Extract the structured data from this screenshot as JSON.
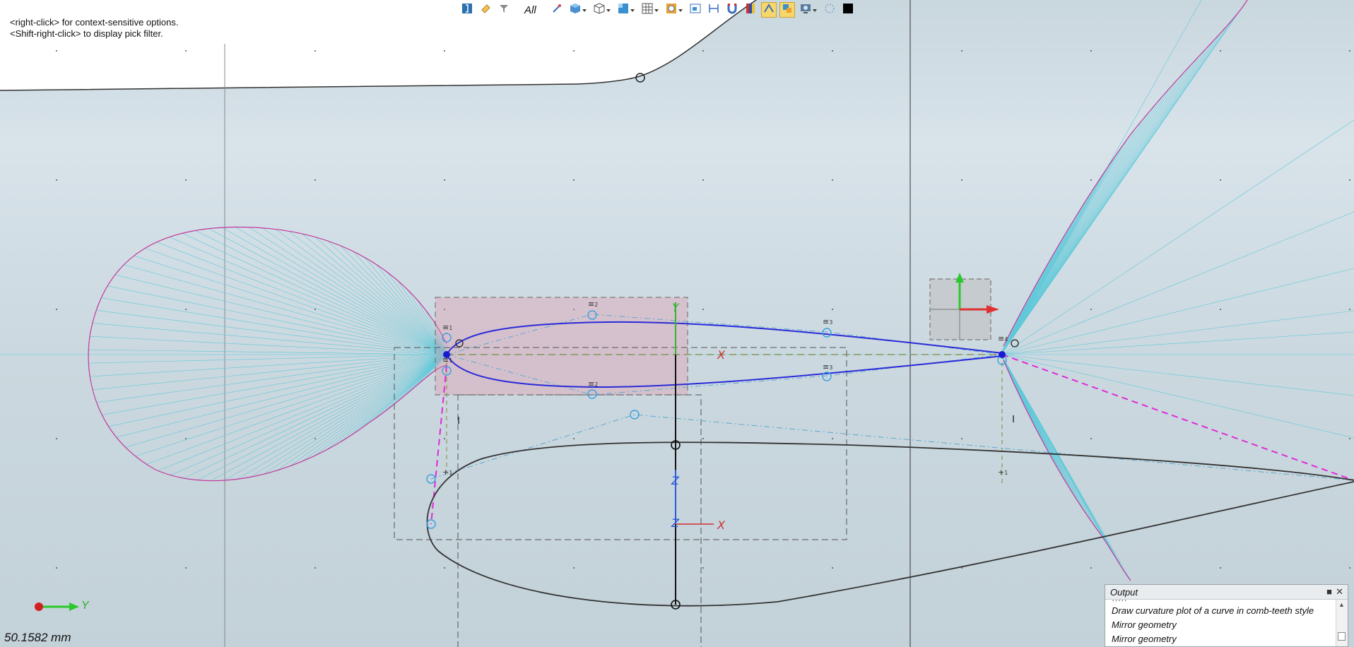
{
  "hints": {
    "line1": "<right-click> for context-sensitive options.",
    "line2": "<Shift-right-click> to display pick filter."
  },
  "toolbar": {
    "filter_label": "All",
    "buttons": [
      {
        "icon": "exit-icon",
        "dropdown": false,
        "active": false
      },
      {
        "icon": "eraser-icon",
        "dropdown": false,
        "active": false
      },
      {
        "icon": "filter-icon",
        "dropdown": false,
        "active": false
      },
      {
        "icon": "wand-icon",
        "dropdown": false,
        "active": false
      },
      {
        "icon": "shaded-cube-icon",
        "dropdown": true,
        "active": false
      },
      {
        "icon": "wireframe-cube-icon",
        "dropdown": true,
        "active": false
      },
      {
        "icon": "view-plane-icon",
        "dropdown": true,
        "active": false
      },
      {
        "icon": "grid-icon",
        "dropdown": true,
        "active": false
      },
      {
        "icon": "snap-target-icon",
        "dropdown": true,
        "active": false
      },
      {
        "icon": "image-icon",
        "dropdown": false,
        "active": false
      },
      {
        "icon": "dimension-icon",
        "dropdown": false,
        "active": false
      },
      {
        "icon": "magnet-icon",
        "dropdown": false,
        "active": false
      },
      {
        "icon": "color-bar-icon",
        "dropdown": false,
        "active": false
      },
      {
        "icon": "curve-select-icon",
        "dropdown": false,
        "active": true
      },
      {
        "icon": "paint-icon",
        "dropdown": false,
        "active": true
      },
      {
        "icon": "display-icon",
        "dropdown": true,
        "active": false
      },
      {
        "icon": "dotted-circle-icon",
        "dropdown": false,
        "active": false
      },
      {
        "icon": "black-square-icon",
        "dropdown": false,
        "active": false
      }
    ]
  },
  "canvas": {
    "axis_labels": {
      "x_main": "X",
      "y_main": "Y",
      "z_mid": "Z",
      "z_lower": "Z",
      "x_lower": "X"
    },
    "constraint_markers": [
      "1",
      "2",
      "3",
      "1",
      "2",
      "3",
      "4",
      "1",
      "1"
    ]
  },
  "triad": {
    "label": "Y"
  },
  "measurement": "50.1582 mm",
  "output": {
    "title": "Output",
    "lines": [
      "Draw curvature plot of a curve in comb-teeth style",
      "Mirror geometry",
      "Mirror geometry"
    ]
  },
  "colors": {
    "viewport_bg": "#cbd8df",
    "curve_blue": "#2a2ad8",
    "comb_cyan": "#5fc9d9",
    "envelope_magenta": "#c03a9c",
    "active_button": "#f7d66a"
  }
}
